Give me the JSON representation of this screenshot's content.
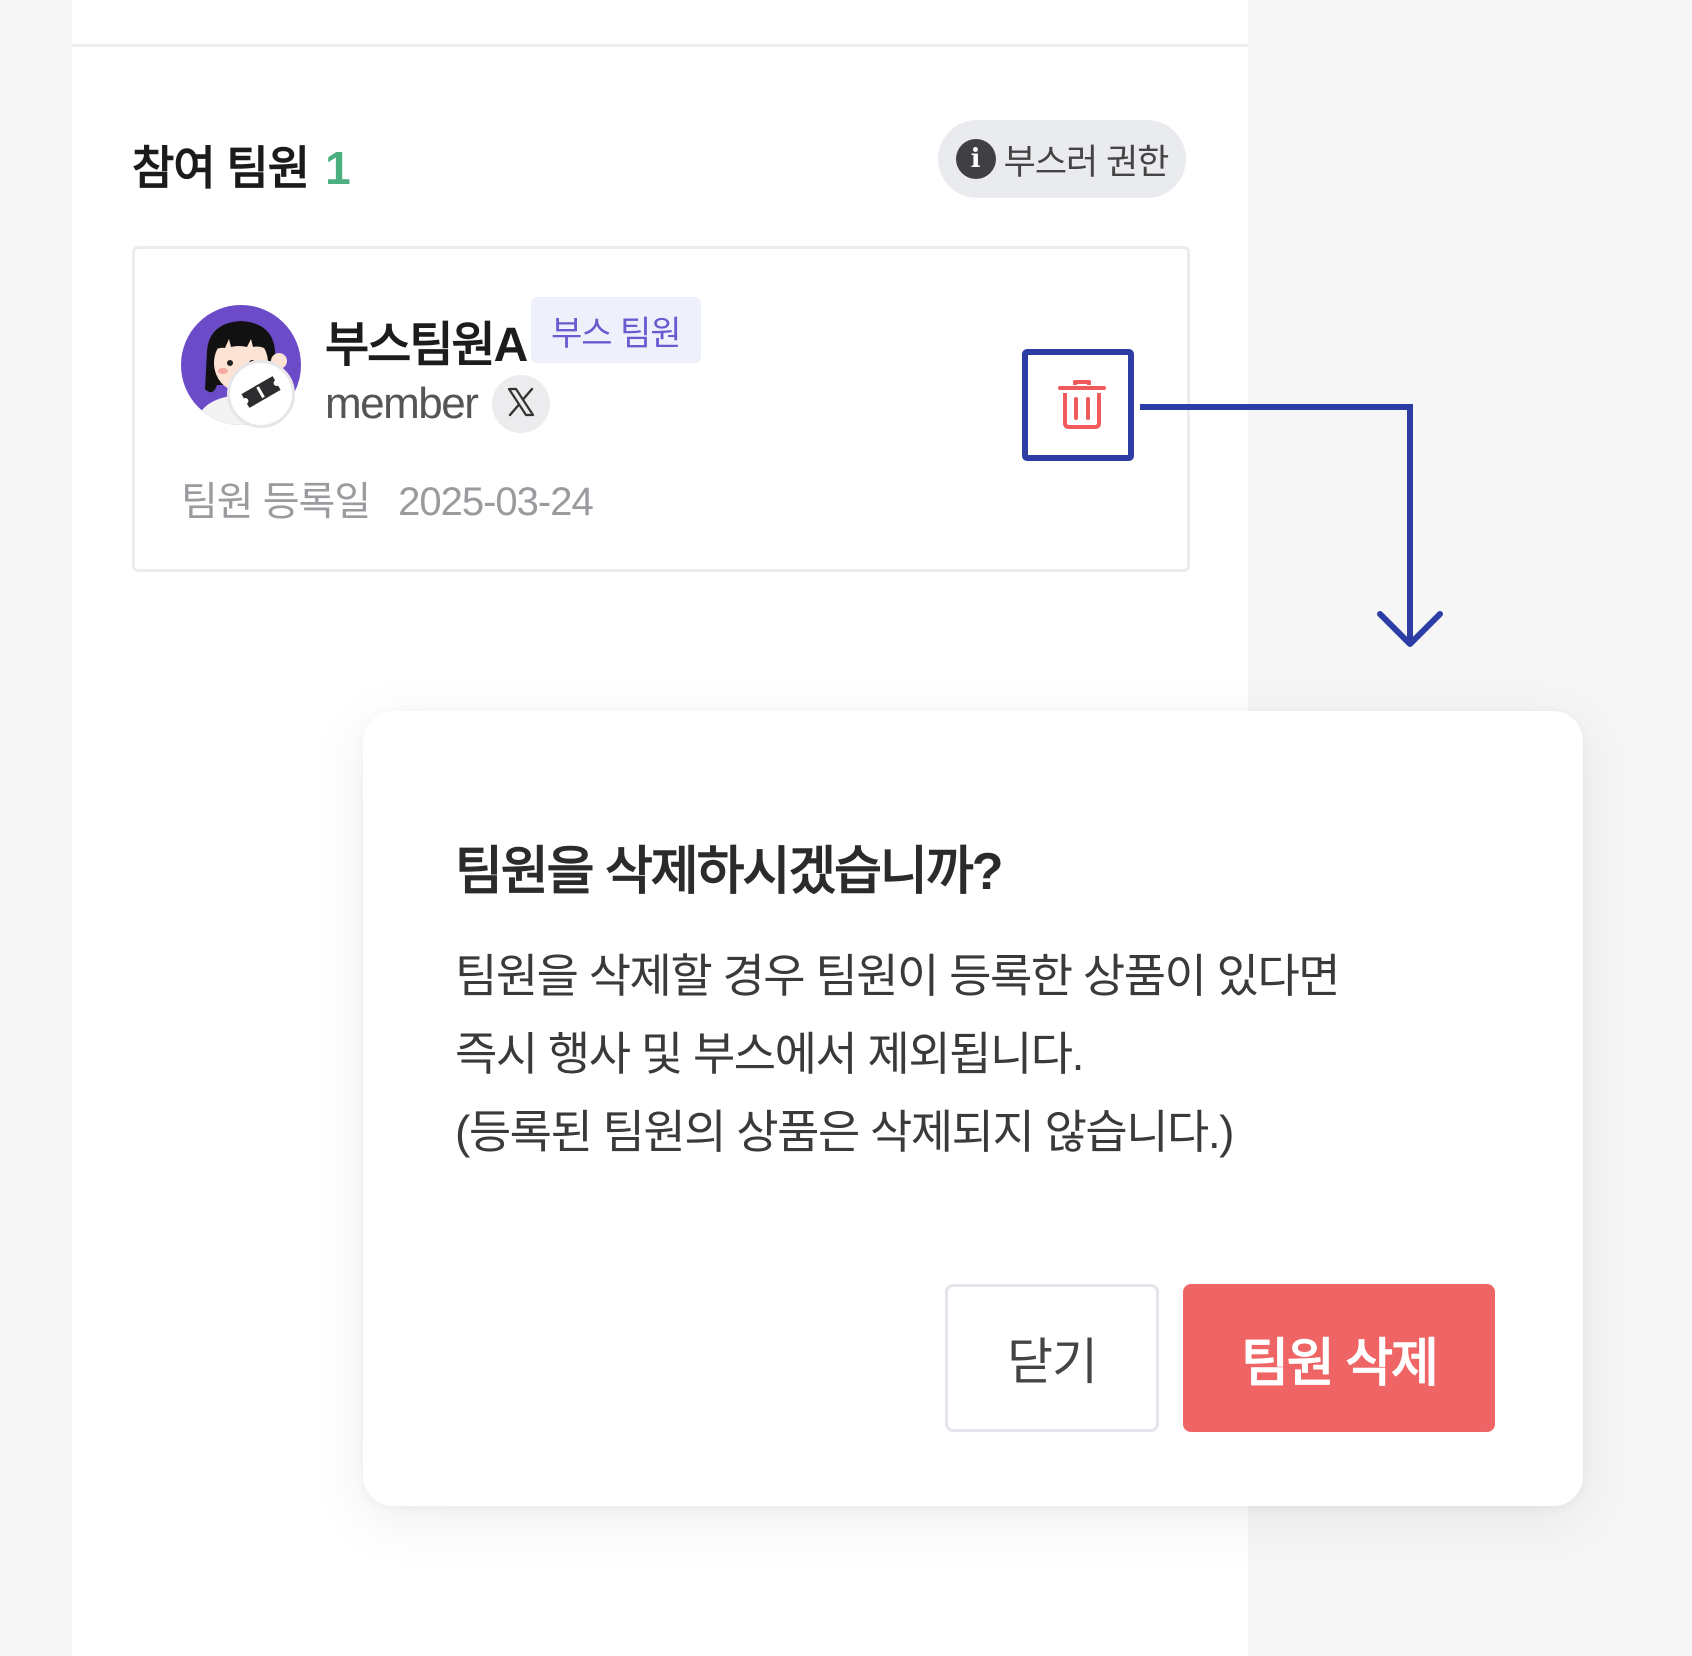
{
  "section": {
    "title": "참여 팀원",
    "count": "1",
    "permission_chip": {
      "icon": "info-icon",
      "label": "부스러 권한"
    }
  },
  "member": {
    "name": "부스팀원A",
    "role_badge": "부스 팀원",
    "handle": "member",
    "social_icon": "x-logo-icon",
    "avatar_badge_icon": "ticket-icon",
    "registered_label": "팀원 등록일",
    "registered_date": "2025-03-24",
    "delete_icon": "trash-icon"
  },
  "dialog": {
    "title": "팀원을 삭제하시겠습니까?",
    "body_lines": [
      "팀원을 삭제할 경우 팀원이 등록한 상품이 있다면",
      "즉시 행사 및 부스에서 제외됩니다.",
      "(등록된 팀원의 상품은 삭제되지 않습니다.)"
    ],
    "close_label": "닫기",
    "delete_label": "팀원 삭제"
  },
  "colors": {
    "accent_green": "#4caf7f",
    "role_purple": "#6a5bd0",
    "danger_red": "#ef6565",
    "highlight_blue": "#2c3ea6",
    "avatar_purple": "#6b4bc8"
  }
}
